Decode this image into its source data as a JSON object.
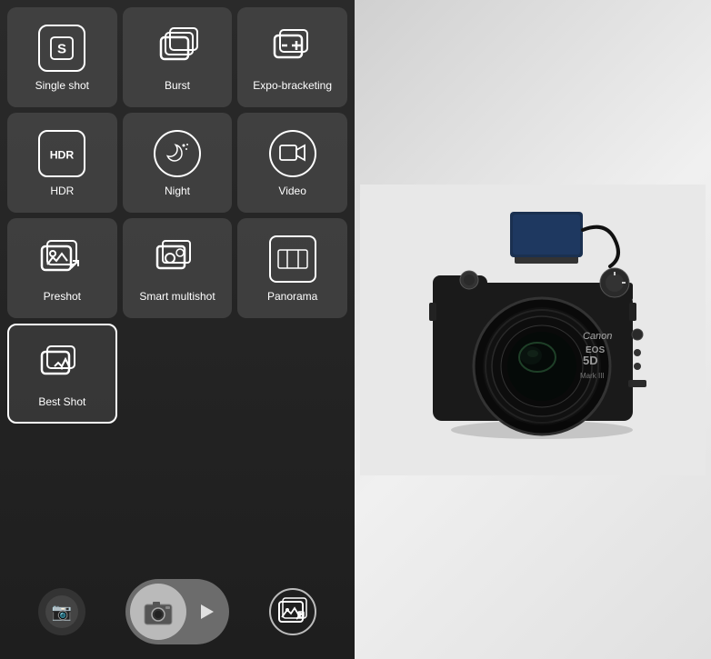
{
  "modes": [
    {
      "id": "single-shot",
      "label": "Single shot",
      "icon_type": "S-square",
      "selected": false
    },
    {
      "id": "burst",
      "label": "Burst",
      "icon_type": "burst",
      "selected": false
    },
    {
      "id": "expo-bracketing",
      "label": "Expo-bracketing",
      "icon_type": "expo",
      "selected": false
    },
    {
      "id": "hdr",
      "label": "HDR",
      "icon_type": "HDR-square",
      "selected": false
    },
    {
      "id": "night",
      "label": "Night",
      "icon_type": "night-circle",
      "selected": false
    },
    {
      "id": "video",
      "label": "Video",
      "icon_type": "video-circle",
      "selected": false
    },
    {
      "id": "preshot",
      "label": "Preshot",
      "icon_type": "preshot",
      "selected": false
    },
    {
      "id": "smart-multishot",
      "label": "Smart multishot",
      "icon_type": "smart-multishot",
      "selected": false
    },
    {
      "id": "panorama",
      "label": "Panorama",
      "icon_type": "panorama",
      "selected": false
    },
    {
      "id": "best-shot",
      "label": "Best Shot",
      "icon_type": "best-shot",
      "selected": true
    }
  ],
  "toolbar": {
    "thumb_icon": "📷",
    "shutter_icon": "📷",
    "video_icon": "🎥",
    "gallery_icon": "🖼"
  }
}
